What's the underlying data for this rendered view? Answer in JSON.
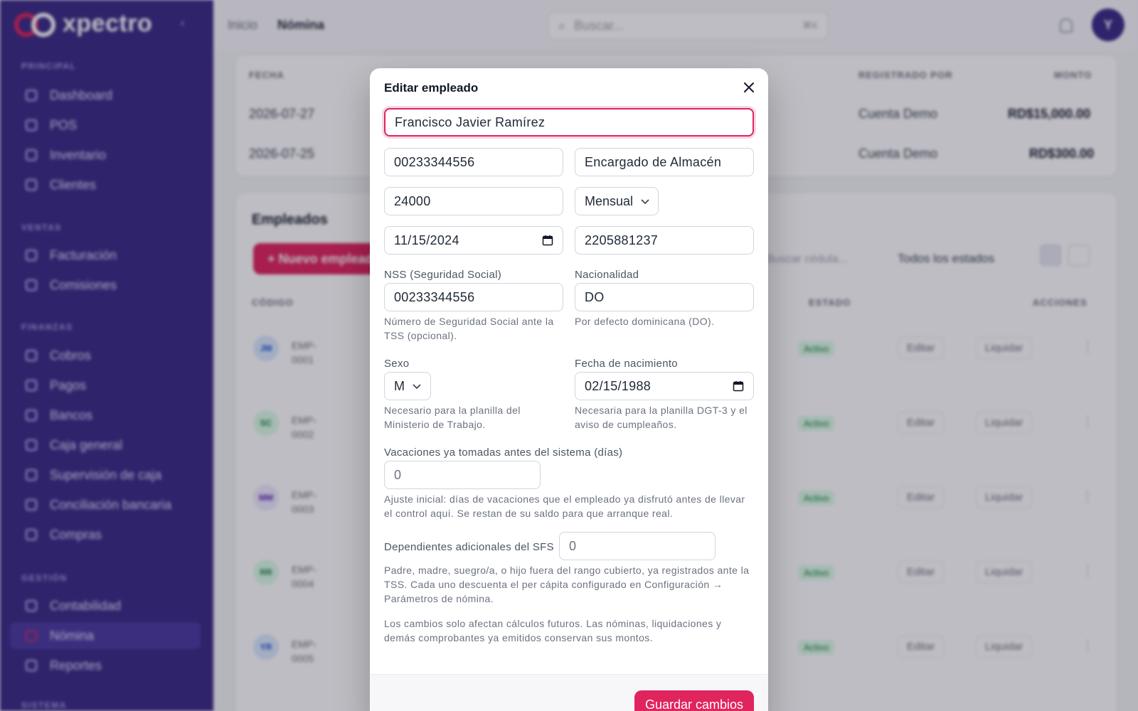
{
  "app": {
    "logo_text": "xpectro",
    "avatar_initial": "Y"
  },
  "sidebar": {
    "sections": [
      {
        "title": "PRINCIPAL",
        "items": [
          "Dashboard",
          "POS",
          "Inventario",
          "Clientes"
        ]
      },
      {
        "title": "VENTAS",
        "items": [
          "Facturación",
          "Comisiones"
        ]
      },
      {
        "title": "FINANZAS",
        "items": [
          "Cobros",
          "Pagos",
          "Bancos",
          "Caja general",
          "Supervisión de caja",
          "Conciliación bancaria",
          "Compras"
        ]
      },
      {
        "title": "GESTIÓN",
        "items": [
          "Contabilidad",
          "Nómina",
          "Reportes"
        ]
      },
      {
        "title": "SISTEMA",
        "items": []
      }
    ],
    "active_item": "Nómina"
  },
  "topbar": {
    "breadcrumb_home": "Inicio",
    "breadcrumb_current": "Nómina",
    "search_placeholder": "Buscar...",
    "search_shortcut": "⌘K"
  },
  "history": {
    "headers": [
      "FECHA",
      "REGISTRADO POR",
      "MONTO"
    ],
    "rows": [
      {
        "date": "2026-07-27",
        "by": "Cuenta Demo",
        "amount": "RD$15,000.00"
      },
      {
        "date": "2026-07-25",
        "by": "Cuenta Demo",
        "amount": "RD$300.00"
      }
    ]
  },
  "employees": {
    "title": "Empleados",
    "new_button": "+ Nuevo empleado",
    "filter_placeholder": "Buscar cédula...",
    "filter_select": "Todos los estados",
    "headers": [
      "CÓDIGO",
      "ESTADO",
      "ACCIONES"
    ],
    "rows": [
      {
        "initials": "JM",
        "code": "EMP-0001",
        "status": "Activo",
        "edit": "Editar",
        "liquidate": "Liquidar"
      },
      {
        "initials": "SC",
        "code": "EMP-0002",
        "status": "Activo",
        "edit": "Editar",
        "liquidate": "Liquidar"
      },
      {
        "initials": "MM",
        "code": "EMP-0003",
        "status": "Activo",
        "edit": "Editar",
        "liquidate": "Liquidar"
      },
      {
        "initials": "RR",
        "code": "EMP-0004",
        "status": "Activo",
        "edit": "Editar",
        "liquidate": "Liquidar"
      },
      {
        "initials": "YR",
        "code": "EMP-0005",
        "status": "Activo",
        "edit": "Editar",
        "liquidate": "Liquidar"
      }
    ]
  },
  "modal": {
    "title": "Editar empleado",
    "name_value": "Francisco Javier Ramírez",
    "cedula_value": "00233344556",
    "position_value": "Encargado de Almacén",
    "salary_value": "24000",
    "frequency_value": "Mensual",
    "hire_date_value": "11/15/2024",
    "phone_value": "2205881237",
    "nss_label": "NSS (Seguridad Social)",
    "nss_value": "00233344556",
    "nss_help": "Número de Seguridad Social ante la TSS (opcional).",
    "nationality_label": "Nacionalidad",
    "nationality_value": "DO",
    "nationality_help": "Por defecto dominicana (DO).",
    "sex_label": "Sexo",
    "sex_value": "M",
    "sex_help": "Necesario para la planilla del Ministerio de Trabajo.",
    "birth_label": "Fecha de nacimiento",
    "birth_value": "02/15/1988",
    "birth_help": "Necesaria para la planilla DGT-3 y el aviso de cumpleaños.",
    "vacation_label": "Vacaciones ya tomadas antes del sistema (días)",
    "vacation_value": "0",
    "vacation_help": "Ajuste inicial: días de vacaciones que el empleado ya disfrutó antes de llevar el control aquí. Se restan de su saldo para que arranque real.",
    "dependents_label": "Dependientes adicionales del SFS",
    "dependents_value": "0",
    "dependents_help": "Padre, madre, suegro/a, o hijo fuera del rango cubierto, ya registrados ante la TSS. Cada uno descuenta el per cápita configurado en Configuración → Parámetros de nómina.",
    "notice": "Los cambios solo afectan cálculos futuros. Las nóminas, liquidaciones y demás comprobantes ya emitidos conservan sus montos.",
    "save_label": "Guardar cambios"
  },
  "colors": {
    "sidebar_bg": "#3a2a86",
    "accent": "#e0245e"
  }
}
